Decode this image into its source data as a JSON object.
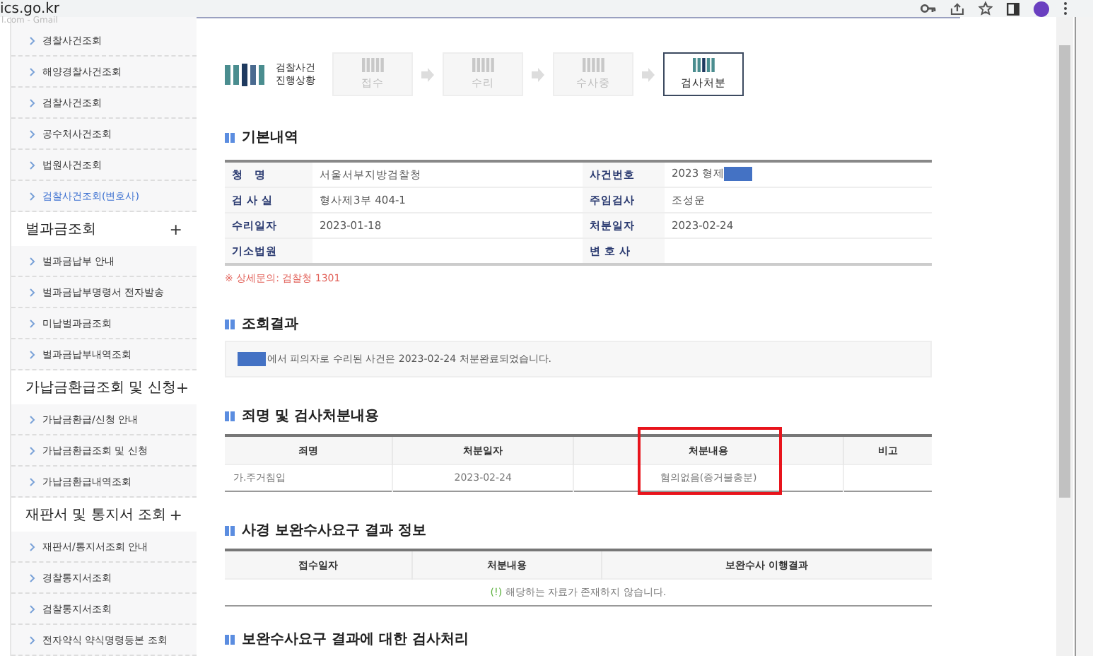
{
  "browser": {
    "url": "ics.go.kr",
    "bookmark": "l.com - Gmail"
  },
  "sidebar": [
    {
      "kind": "item",
      "label": "경찰사건조회",
      "selected": false
    },
    {
      "kind": "item",
      "label": "해양경찰사건조회",
      "selected": false
    },
    {
      "kind": "item",
      "label": "검찰사건조회",
      "selected": false
    },
    {
      "kind": "item",
      "label": "공수처사건조회",
      "selected": false
    },
    {
      "kind": "item",
      "label": "법원사건조회",
      "selected": false
    },
    {
      "kind": "item",
      "label": "검찰사건조회(변호사)",
      "selected": true
    },
    {
      "kind": "group",
      "label": "벌과금조회",
      "toggle": "+"
    },
    {
      "kind": "item",
      "label": "벌과금납부 안내",
      "selected": false
    },
    {
      "kind": "item",
      "label": "벌과금납부명령서 전자발송",
      "selected": false
    },
    {
      "kind": "item",
      "label": "미납벌과금조회",
      "selected": false
    },
    {
      "kind": "item",
      "label": "벌과금납부내역조회",
      "selected": false
    },
    {
      "kind": "group",
      "label": "가납금환급조회 및 신청",
      "toggle": "+"
    },
    {
      "kind": "item",
      "label": "가납금환급/신청 안내",
      "selected": false
    },
    {
      "kind": "item",
      "label": "가납금환급조회 및 신청",
      "selected": false
    },
    {
      "kind": "item",
      "label": "가납금환급내역조회",
      "selected": false
    },
    {
      "kind": "group",
      "label": "재판서 및 통지서 조회",
      "toggle": "+"
    },
    {
      "kind": "item",
      "label": "재판서/통지서조회 안내",
      "selected": false
    },
    {
      "kind": "item",
      "label": "경찰통지서조회",
      "selected": false
    },
    {
      "kind": "item",
      "label": "검찰통지서조회",
      "selected": false
    },
    {
      "kind": "item",
      "label": "전자약식 약식명령등본 조회",
      "selected": false
    }
  ],
  "progress": {
    "title": [
      "검찰사건",
      "진행상황"
    ],
    "steps": [
      {
        "label": "접수",
        "selected": false
      },
      {
        "label": "수리",
        "selected": false
      },
      {
        "label": "수사중",
        "selected": false
      },
      {
        "label": "검사처분",
        "selected": true
      }
    ]
  },
  "basic": {
    "title": "기본내역",
    "rows": [
      [
        {
          "label": "청　명",
          "value": "서울서부지방검찰청"
        },
        {
          "label": "사건번호",
          "value": "2023 형제",
          "redacted": true
        }
      ],
      [
        {
          "label": "검 사 실",
          "value": "형사제3부 404-1"
        },
        {
          "label": "주임검사",
          "value": "조성운"
        }
      ],
      [
        {
          "label": "수리일자",
          "value": "2023-01-18"
        },
        {
          "label": "처분일자",
          "value": "2023-02-24"
        }
      ],
      [
        {
          "label": "기소법원"
        },
        {
          "label": "변 호 사"
        }
      ]
    ],
    "note": "※ 상세문의: 검찰청 1301"
  },
  "result": {
    "title": "조회결과",
    "text": "에서 피의자로 수리된 사건은 2023-02-24 처분완료되었습니다.",
    "redacted": true
  },
  "charges": {
    "title": "죄명 및 검사처분내용",
    "columns": [
      {
        "label": "죄명",
        "highlighted": false
      },
      {
        "label": "처분일자",
        "highlighted": false
      },
      {
        "label": "처분내용",
        "highlighted": true
      },
      {
        "label": "비고",
        "highlighted": false
      }
    ],
    "rows": [
      [
        "가.주거침입",
        "2023-02-24",
        "혐의없음(증거불충분)",
        ""
      ]
    ]
  },
  "supplement": {
    "title": "사경 보완수사요구 결과 정보",
    "columns": [
      "접수일자",
      "처분내용",
      "보완수사 이행결과"
    ],
    "empty": {
      "mark": "(!)",
      "text": "해당하는 자료가 존재하지 않습니다."
    }
  },
  "last_section": {
    "title": "보완수사요구 결과에 대한 검사처리"
  }
}
